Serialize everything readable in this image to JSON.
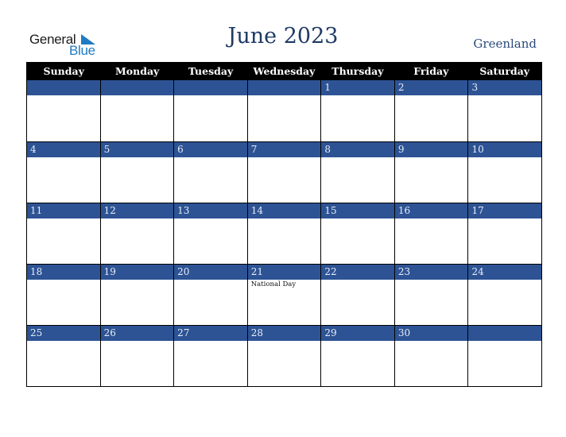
{
  "logo": {
    "word1": "General",
    "word2": "Blue",
    "accent": "#1f7bc1"
  },
  "header": {
    "title": "June 2023",
    "country": "Greenland"
  },
  "colors": {
    "header_bg": "#000000",
    "date_bar": "#2d5394",
    "title": "#1f3a66"
  },
  "weekdays": [
    "Sunday",
    "Monday",
    "Tuesday",
    "Wednesday",
    "Thursday",
    "Friday",
    "Saturday"
  ],
  "weeks": [
    {
      "days": [
        {
          "date": "",
          "event": ""
        },
        {
          "date": "",
          "event": ""
        },
        {
          "date": "",
          "event": ""
        },
        {
          "date": "",
          "event": ""
        },
        {
          "date": "1",
          "event": ""
        },
        {
          "date": "2",
          "event": ""
        },
        {
          "date": "3",
          "event": ""
        }
      ]
    },
    {
      "days": [
        {
          "date": "4",
          "event": ""
        },
        {
          "date": "5",
          "event": ""
        },
        {
          "date": "6",
          "event": ""
        },
        {
          "date": "7",
          "event": ""
        },
        {
          "date": "8",
          "event": ""
        },
        {
          "date": "9",
          "event": ""
        },
        {
          "date": "10",
          "event": ""
        }
      ]
    },
    {
      "days": [
        {
          "date": "11",
          "event": ""
        },
        {
          "date": "12",
          "event": ""
        },
        {
          "date": "13",
          "event": ""
        },
        {
          "date": "14",
          "event": ""
        },
        {
          "date": "15",
          "event": ""
        },
        {
          "date": "16",
          "event": ""
        },
        {
          "date": "17",
          "event": ""
        }
      ]
    },
    {
      "days": [
        {
          "date": "18",
          "event": ""
        },
        {
          "date": "19",
          "event": ""
        },
        {
          "date": "20",
          "event": ""
        },
        {
          "date": "21",
          "event": "National Day"
        },
        {
          "date": "22",
          "event": ""
        },
        {
          "date": "23",
          "event": ""
        },
        {
          "date": "24",
          "event": ""
        }
      ]
    },
    {
      "days": [
        {
          "date": "25",
          "event": ""
        },
        {
          "date": "26",
          "event": ""
        },
        {
          "date": "27",
          "event": ""
        },
        {
          "date": "28",
          "event": ""
        },
        {
          "date": "29",
          "event": ""
        },
        {
          "date": "30",
          "event": ""
        },
        {
          "date": "",
          "event": ""
        }
      ]
    }
  ]
}
